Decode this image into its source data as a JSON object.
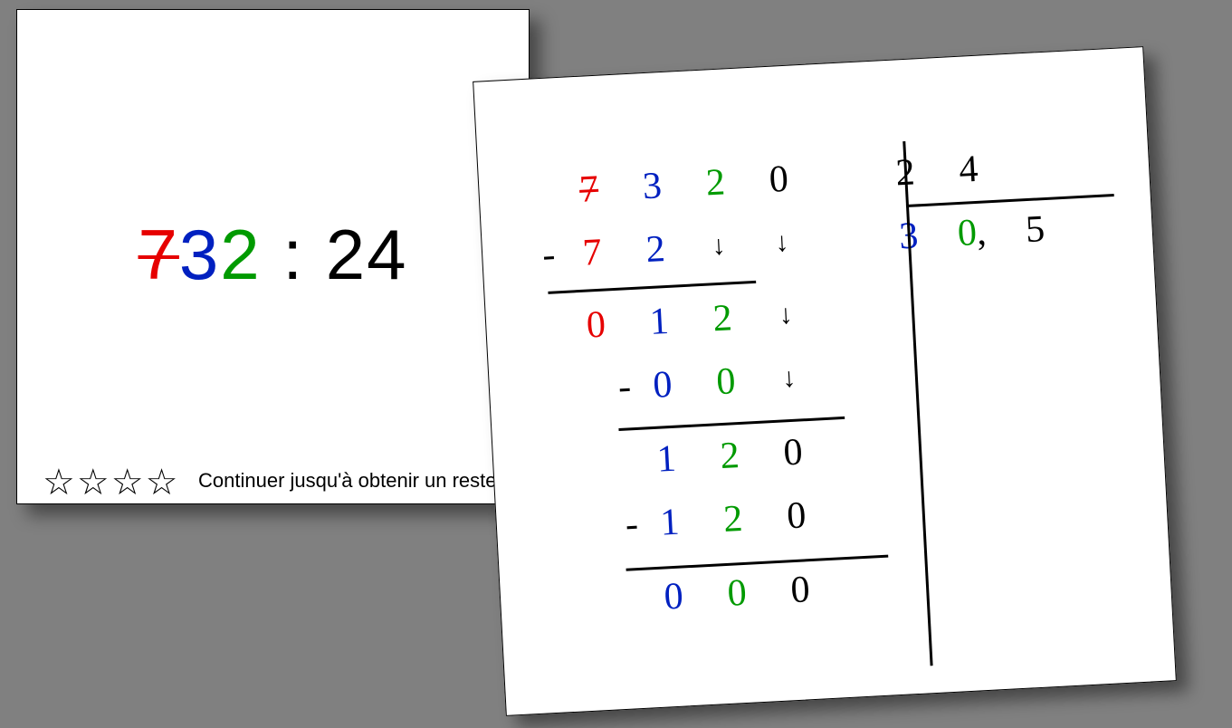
{
  "problem": {
    "d1": "7",
    "d2": "3",
    "d3": "2",
    "colon": " : ",
    "divisor": "24"
  },
  "stars": "☆☆☆☆",
  "instruction": "Continuer jusqu'à obtenir un reste nul",
  "division": {
    "dividend": {
      "c1": "7",
      "c2": "3",
      "c3": "2",
      "c4": "0"
    },
    "divisor": {
      "d1": "2",
      "d2": "4"
    },
    "quotient": {
      "q1": "3",
      "q2": "0",
      "comma": ",",
      "q3": "5"
    },
    "r1": {
      "sign": "-",
      "c1": "7",
      "c2": "2",
      "a3": "↓",
      "a4": "↓"
    },
    "r2": {
      "c1": "0",
      "c2": "1",
      "c3": "2",
      "a4": "↓"
    },
    "r3": {
      "sign": "-",
      "c2": "0",
      "c3": "0",
      "a4": "↓"
    },
    "r4": {
      "c2": "1",
      "c3": "2",
      "c4": "0"
    },
    "r5": {
      "sign": "-",
      "c2": "1",
      "c3": "2",
      "c4": "0"
    },
    "r6": {
      "c2": "0",
      "c3": "0",
      "c4": "0"
    }
  }
}
